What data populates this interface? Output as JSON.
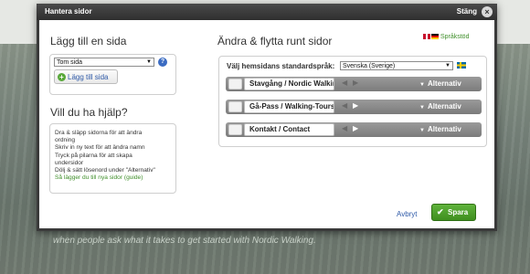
{
  "dialog": {
    "title": "Hantera sidor",
    "close_label": "Stäng",
    "close_icon": "close-icon"
  },
  "add_page": {
    "heading": "Lägg till en sida",
    "select_value": "Tom sida",
    "button_label": "Lägg till sida"
  },
  "help": {
    "heading": "Vill du ha hjälp?",
    "lines": [
      "Dra & släpp sidorna för att ändra",
      "ordning",
      "Skriv in ny text för att ändra namn",
      "Tryck på pilarna för att skapa",
      "undersidor",
      "Dölj & sätt lösenord under \"Alternativ\""
    ],
    "guide_link": "Så lägger du till nya sidor (guide)"
  },
  "edit": {
    "heading": "Ändra & flytta runt sidor",
    "language_support": "Språkstöd",
    "default_language_label": "Välj hemsidans standardspråk:",
    "default_language_value": "Svenska (Sverige)",
    "pages": [
      {
        "name": "Stavgång / Nordic Walkir",
        "options": "Alternativ"
      },
      {
        "name": "Gå-Pass / Walking-Tours",
        "options": "Alternativ"
      },
      {
        "name": "Kontakt / Contact",
        "options": "Alternativ"
      }
    ]
  },
  "footer": {
    "cancel_label": "Avbryt",
    "save_label": "Spara"
  },
  "background": {
    "caption": "when people ask what it takes to get started with Nordic Walking."
  },
  "colors": {
    "accent_green": "#4aa12a",
    "link_blue": "#2f5aa8",
    "header_dark": "#333333"
  }
}
